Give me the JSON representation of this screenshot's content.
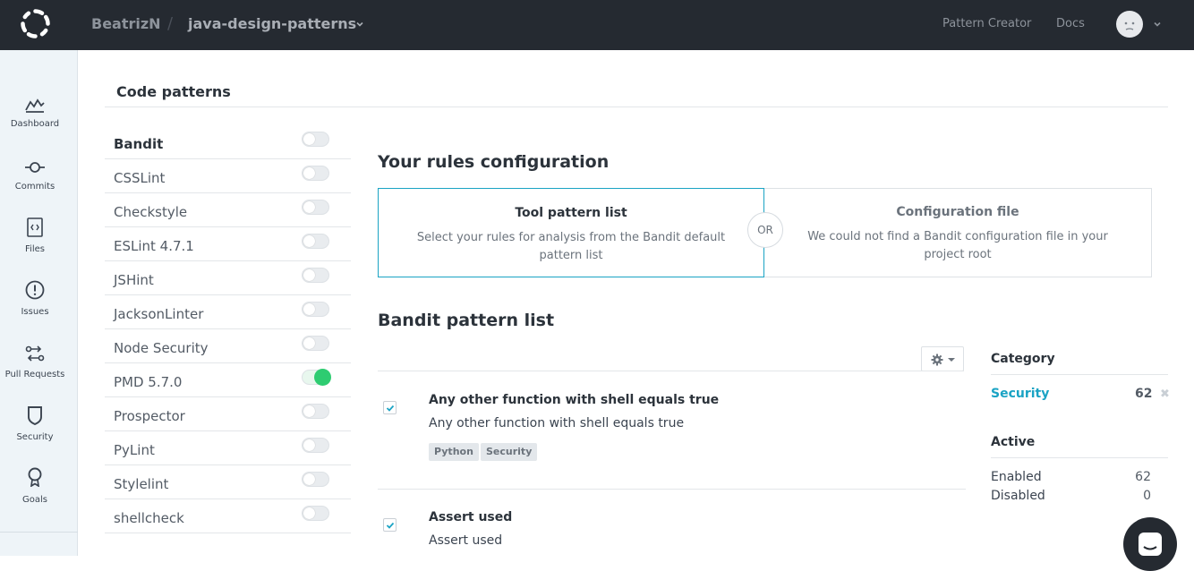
{
  "topbar": {
    "org": "BeatrizN",
    "separator": "/",
    "repo": "java-design-patterns",
    "links": [
      "Pattern Creator",
      "Docs"
    ]
  },
  "sidebar": {
    "items": [
      {
        "label": "Dashboard",
        "icon": "dashboard-icon"
      },
      {
        "label": "Commits",
        "icon": "commit-icon"
      },
      {
        "label": "Files",
        "icon": "file-icon"
      },
      {
        "label": "Issues",
        "icon": "issues-icon"
      },
      {
        "label": "Pull Requests",
        "icon": "pull-request-icon"
      },
      {
        "label": "Security",
        "icon": "shield-icon"
      },
      {
        "label": "Goals",
        "icon": "goal-icon"
      }
    ]
  },
  "main": {
    "title": "Code patterns",
    "tools": [
      {
        "name": "Bandit",
        "enabled": false,
        "selected": true
      },
      {
        "name": "CSSLint",
        "enabled": false
      },
      {
        "name": "Checkstyle",
        "enabled": false
      },
      {
        "name": "ESLint 4.7.1",
        "enabled": false
      },
      {
        "name": "JSHint",
        "enabled": false
      },
      {
        "name": "JacksonLinter",
        "enabled": false
      },
      {
        "name": "Node Security",
        "enabled": false
      },
      {
        "name": "PMD 5.7.0",
        "enabled": true
      },
      {
        "name": "Prospector",
        "enabled": false
      },
      {
        "name": "PyLint",
        "enabled": false
      },
      {
        "name": "Stylelint",
        "enabled": false
      },
      {
        "name": "shellcheck",
        "enabled": false
      }
    ],
    "rules_config": {
      "title": "Your rules configuration",
      "option_left": {
        "title": "Tool pattern list",
        "desc": "Select your rules for analysis from the Bandit default pattern list"
      },
      "or": "OR",
      "option_right": {
        "title": "Configuration file",
        "desc": "We could not find a Bandit configuration file in your project root"
      }
    },
    "pattern_list": {
      "title": "Bandit pattern list",
      "items": [
        {
          "title": "Any other function with shell equals true",
          "desc": "Any other function with shell equals true",
          "tags": [
            "Python",
            "Security"
          ],
          "checked": true
        },
        {
          "title": "Assert used",
          "desc": "Assert used",
          "tags": [],
          "checked": true
        }
      ]
    },
    "filters": {
      "category_title": "Category",
      "category": {
        "name": "Security",
        "count": "62"
      },
      "active_title": "Active",
      "enabled": {
        "label": "Enabled",
        "count": "62"
      },
      "disabled": {
        "label": "Disabled",
        "count": "0"
      }
    }
  },
  "colors": {
    "topbar": "#252a31",
    "accent": "#1aa3c4",
    "toggle_on": "#2ecc71",
    "sidebar_bg": "#eef4f8"
  }
}
